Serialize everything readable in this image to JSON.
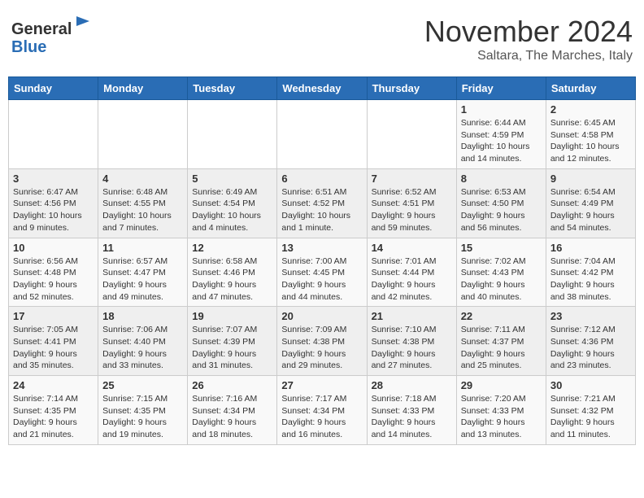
{
  "header": {
    "logo_line1": "General",
    "logo_line2": "Blue",
    "title": "November 2024",
    "subtitle": "Saltara, The Marches, Italy"
  },
  "weekdays": [
    "Sunday",
    "Monday",
    "Tuesday",
    "Wednesday",
    "Thursday",
    "Friday",
    "Saturday"
  ],
  "weeks": [
    [
      {
        "day": "",
        "info": ""
      },
      {
        "day": "",
        "info": ""
      },
      {
        "day": "",
        "info": ""
      },
      {
        "day": "",
        "info": ""
      },
      {
        "day": "",
        "info": ""
      },
      {
        "day": "1",
        "info": "Sunrise: 6:44 AM\nSunset: 4:59 PM\nDaylight: 10 hours and 14 minutes."
      },
      {
        "day": "2",
        "info": "Sunrise: 6:45 AM\nSunset: 4:58 PM\nDaylight: 10 hours and 12 minutes."
      }
    ],
    [
      {
        "day": "3",
        "info": "Sunrise: 6:47 AM\nSunset: 4:56 PM\nDaylight: 10 hours and 9 minutes."
      },
      {
        "day": "4",
        "info": "Sunrise: 6:48 AM\nSunset: 4:55 PM\nDaylight: 10 hours and 7 minutes."
      },
      {
        "day": "5",
        "info": "Sunrise: 6:49 AM\nSunset: 4:54 PM\nDaylight: 10 hours and 4 minutes."
      },
      {
        "day": "6",
        "info": "Sunrise: 6:51 AM\nSunset: 4:52 PM\nDaylight: 10 hours and 1 minute."
      },
      {
        "day": "7",
        "info": "Sunrise: 6:52 AM\nSunset: 4:51 PM\nDaylight: 9 hours and 59 minutes."
      },
      {
        "day": "8",
        "info": "Sunrise: 6:53 AM\nSunset: 4:50 PM\nDaylight: 9 hours and 56 minutes."
      },
      {
        "day": "9",
        "info": "Sunrise: 6:54 AM\nSunset: 4:49 PM\nDaylight: 9 hours and 54 minutes."
      }
    ],
    [
      {
        "day": "10",
        "info": "Sunrise: 6:56 AM\nSunset: 4:48 PM\nDaylight: 9 hours and 52 minutes."
      },
      {
        "day": "11",
        "info": "Sunrise: 6:57 AM\nSunset: 4:47 PM\nDaylight: 9 hours and 49 minutes."
      },
      {
        "day": "12",
        "info": "Sunrise: 6:58 AM\nSunset: 4:46 PM\nDaylight: 9 hours and 47 minutes."
      },
      {
        "day": "13",
        "info": "Sunrise: 7:00 AM\nSunset: 4:45 PM\nDaylight: 9 hours and 44 minutes."
      },
      {
        "day": "14",
        "info": "Sunrise: 7:01 AM\nSunset: 4:44 PM\nDaylight: 9 hours and 42 minutes."
      },
      {
        "day": "15",
        "info": "Sunrise: 7:02 AM\nSunset: 4:43 PM\nDaylight: 9 hours and 40 minutes."
      },
      {
        "day": "16",
        "info": "Sunrise: 7:04 AM\nSunset: 4:42 PM\nDaylight: 9 hours and 38 minutes."
      }
    ],
    [
      {
        "day": "17",
        "info": "Sunrise: 7:05 AM\nSunset: 4:41 PM\nDaylight: 9 hours and 35 minutes."
      },
      {
        "day": "18",
        "info": "Sunrise: 7:06 AM\nSunset: 4:40 PM\nDaylight: 9 hours and 33 minutes."
      },
      {
        "day": "19",
        "info": "Sunrise: 7:07 AM\nSunset: 4:39 PM\nDaylight: 9 hours and 31 minutes."
      },
      {
        "day": "20",
        "info": "Sunrise: 7:09 AM\nSunset: 4:38 PM\nDaylight: 9 hours and 29 minutes."
      },
      {
        "day": "21",
        "info": "Sunrise: 7:10 AM\nSunset: 4:38 PM\nDaylight: 9 hours and 27 minutes."
      },
      {
        "day": "22",
        "info": "Sunrise: 7:11 AM\nSunset: 4:37 PM\nDaylight: 9 hours and 25 minutes."
      },
      {
        "day": "23",
        "info": "Sunrise: 7:12 AM\nSunset: 4:36 PM\nDaylight: 9 hours and 23 minutes."
      }
    ],
    [
      {
        "day": "24",
        "info": "Sunrise: 7:14 AM\nSunset: 4:35 PM\nDaylight: 9 hours and 21 minutes."
      },
      {
        "day": "25",
        "info": "Sunrise: 7:15 AM\nSunset: 4:35 PM\nDaylight: 9 hours and 19 minutes."
      },
      {
        "day": "26",
        "info": "Sunrise: 7:16 AM\nSunset: 4:34 PM\nDaylight: 9 hours and 18 minutes."
      },
      {
        "day": "27",
        "info": "Sunrise: 7:17 AM\nSunset: 4:34 PM\nDaylight: 9 hours and 16 minutes."
      },
      {
        "day": "28",
        "info": "Sunrise: 7:18 AM\nSunset: 4:33 PM\nDaylight: 9 hours and 14 minutes."
      },
      {
        "day": "29",
        "info": "Sunrise: 7:20 AM\nSunset: 4:33 PM\nDaylight: 9 hours and 13 minutes."
      },
      {
        "day": "30",
        "info": "Sunrise: 7:21 AM\nSunset: 4:32 PM\nDaylight: 9 hours and 11 minutes."
      }
    ]
  ]
}
